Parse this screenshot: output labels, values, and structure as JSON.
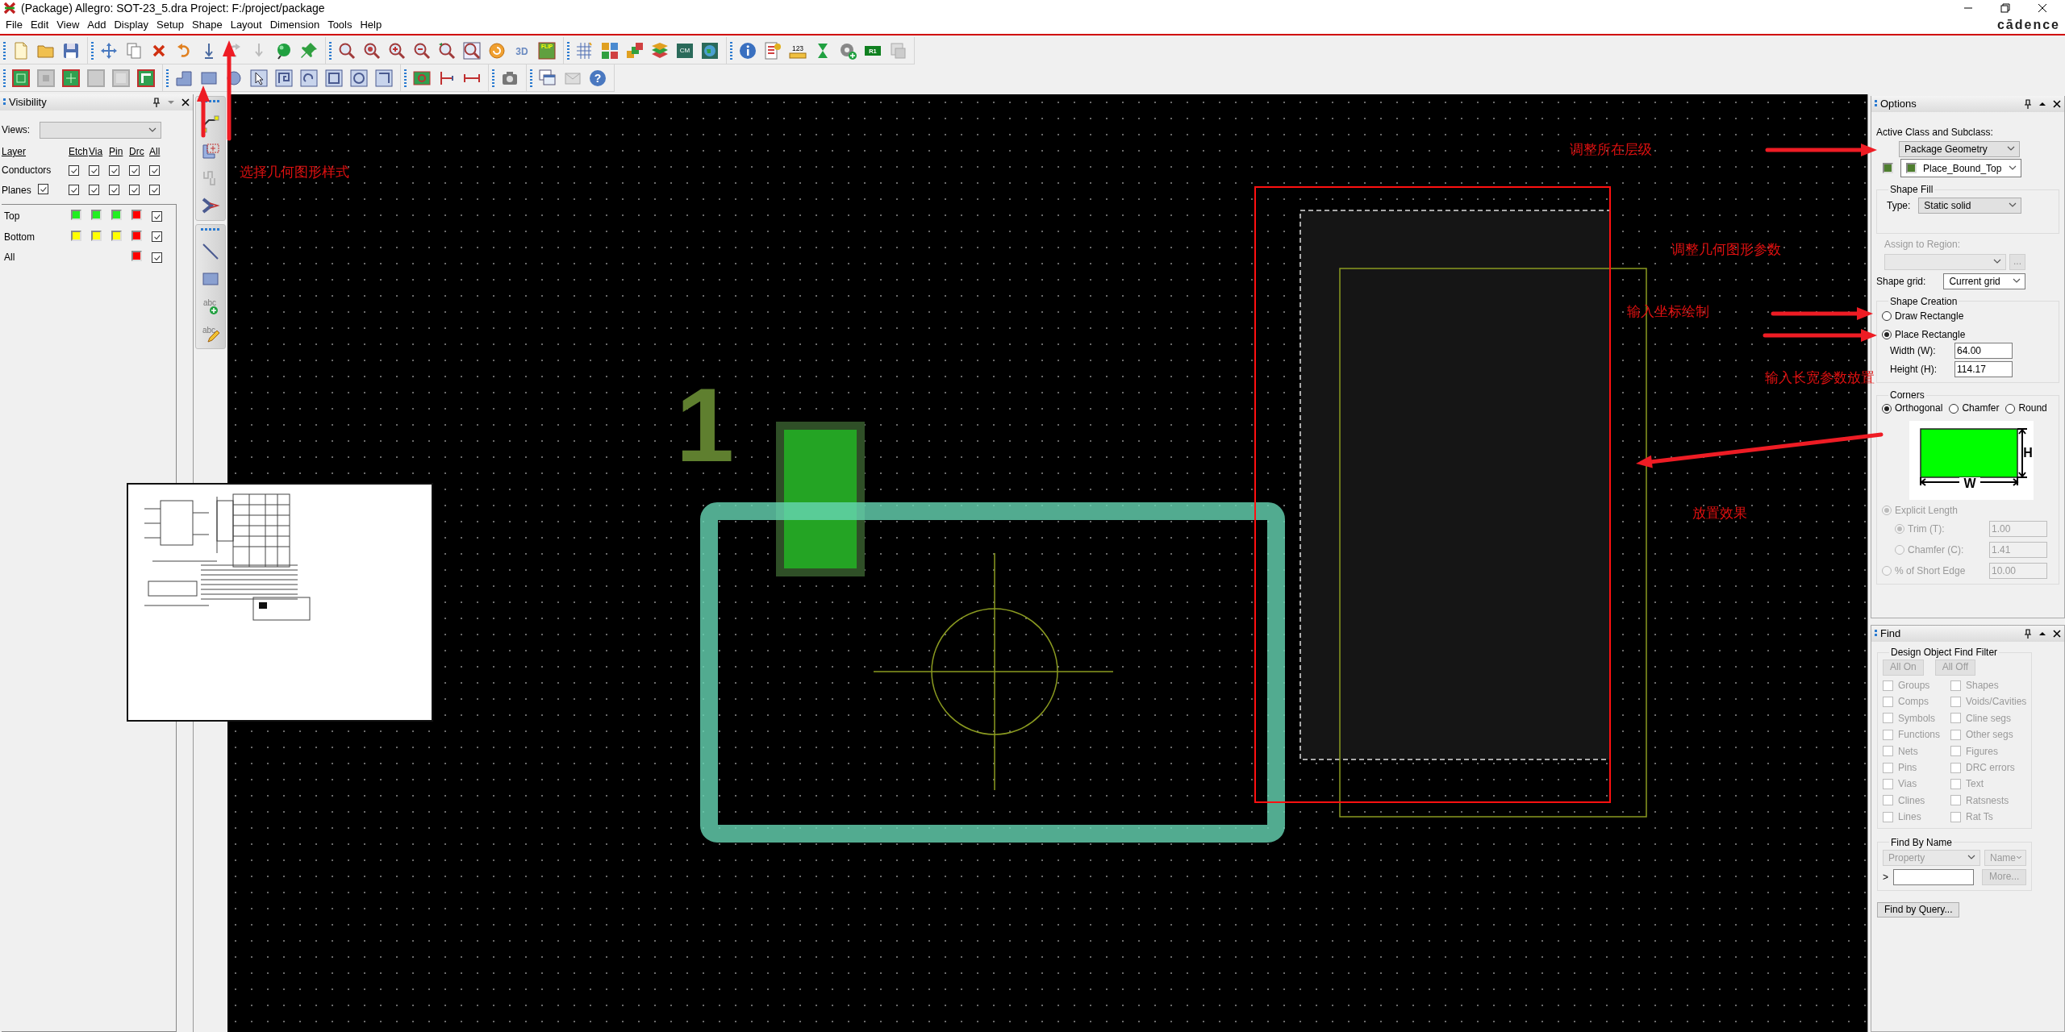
{
  "window": {
    "title": "(Package) Allegro: SOT-23_5.dra  Project: F:/project/package",
    "brand": "cādence"
  },
  "menu": [
    "File",
    "Edit",
    "View",
    "Add",
    "Display",
    "Setup",
    "Shape",
    "Layout",
    "Dimension",
    "Tools",
    "Help"
  ],
  "toolbar_glyphs": {
    "three_d": "3D",
    "flip": "FLIP",
    "cm": "CM",
    "ruler": "123",
    "r1": "R1",
    "help": "?",
    "text_add": "abc",
    "text_edit": "abc"
  },
  "visibility": {
    "title": "Visibility",
    "views_label": "Views:",
    "columns": [
      "Layer",
      "Etch",
      "Via",
      "Pin",
      "Drc",
      "All"
    ],
    "groups": [
      {
        "label": "Conductors",
        "checks": [
          true,
          true,
          true,
          true,
          true
        ]
      },
      {
        "label": "Planes",
        "self_checked": true,
        "checks": [
          true,
          true,
          true,
          true,
          true
        ]
      }
    ],
    "layers": [
      {
        "label": "Top",
        "etch": {
          "color": "#22ee22"
        },
        "via": {
          "color": "#22ee22"
        },
        "pin": {
          "color": "#22ee22"
        },
        "drc": {
          "color": "#ff0000"
        },
        "all": true
      },
      {
        "label": "Bottom",
        "etch": {
          "color": "#ffff00"
        },
        "via": {
          "color": "#ffff00"
        },
        "pin": {
          "color": "#ffff00"
        },
        "drc": {
          "color": "#ff0000"
        },
        "all": true
      },
      {
        "label": "All",
        "drc": {
          "color": "#ff0000"
        },
        "all": true
      }
    ]
  },
  "options": {
    "title": "Options",
    "class_label": "Active Class and Subclass:",
    "class_value": "Package Geometry",
    "subclass": {
      "value": "Place_Bound_Top",
      "color": "#4f7f2f"
    },
    "shape_fill": {
      "legend": "Shape Fill",
      "type_label": "Type:",
      "type_value": "Static solid"
    },
    "assign": {
      "label": "Assign to Region:",
      "button": "...",
      "disabled": true
    },
    "grid": {
      "label": "Shape grid:",
      "value": "Current grid"
    },
    "creation": {
      "legend": "Shape Creation",
      "modes": [
        {
          "label": "Draw Rectangle",
          "selected": false
        },
        {
          "label": "Place Rectangle",
          "selected": true
        }
      ],
      "fields": [
        {
          "label": "Width (W):",
          "value": "64.00"
        },
        {
          "label": "Height (H):",
          "value": "114.17"
        }
      ]
    },
    "corners": {
      "legend": "Corners",
      "options": [
        {
          "label": "Orthogonal",
          "selected": true
        },
        {
          "label": "Chamfer",
          "selected": false
        },
        {
          "label": "Round",
          "selected": false
        }
      ],
      "diagram_labels": [
        "H",
        "W"
      ],
      "lengths": [
        {
          "label": "Explicit Length",
          "selected": true,
          "disabled": true,
          "children": [
            {
              "label": "Trim (T):",
              "selected": true,
              "disabled": true,
              "value": "1.00"
            },
            {
              "label": "Chamfer (C):",
              "selected": false,
              "disabled": true,
              "value": "1.41"
            }
          ]
        },
        {
          "label": "% of Short Edge",
          "selected": false,
          "disabled": true,
          "value": "10.00"
        }
      ]
    }
  },
  "find": {
    "title": "Find",
    "filter_legend": "Design Object Find Filter",
    "buttons": [
      "All On",
      "All Off"
    ],
    "items": [
      {
        "label": "Groups",
        "checked": false
      },
      {
        "label": "Shapes",
        "checked": false
      },
      {
        "label": "Comps",
        "checked": false
      },
      {
        "label": "Voids/Cavities",
        "checked": false
      },
      {
        "label": "Symbols",
        "checked": false
      },
      {
        "label": "Cline segs",
        "checked": false
      },
      {
        "label": "Functions",
        "checked": false
      },
      {
        "label": "Other segs",
        "checked": false
      },
      {
        "label": "Nets",
        "checked": false
      },
      {
        "label": "Figures",
        "checked": false
      },
      {
        "label": "Pins",
        "checked": false
      },
      {
        "label": "DRC errors",
        "checked": false
      },
      {
        "label": "Vias",
        "checked": false
      },
      {
        "label": "Text",
        "checked": false
      },
      {
        "label": "Clines",
        "checked": false
      },
      {
        "label": "Ratsnests",
        "checked": false
      },
      {
        "label": "Lines",
        "checked": false
      },
      {
        "label": "Rat Ts",
        "checked": false
      }
    ],
    "by_name": {
      "legend": "Find By Name",
      "property": "Property",
      "name": "Name",
      "prompt": ">",
      "more": "More..."
    },
    "query_button": "Find by Query..."
  },
  "canvas": {
    "pin_label": "1"
  },
  "annotations": [
    {
      "text": "选择几何图形样式"
    },
    {
      "text": "调整所在层级"
    },
    {
      "text": "调整几何图形参数"
    },
    {
      "text": "输入坐标绘制"
    },
    {
      "text": "输入长宽参数放置"
    },
    {
      "text": "放置效果"
    }
  ]
}
